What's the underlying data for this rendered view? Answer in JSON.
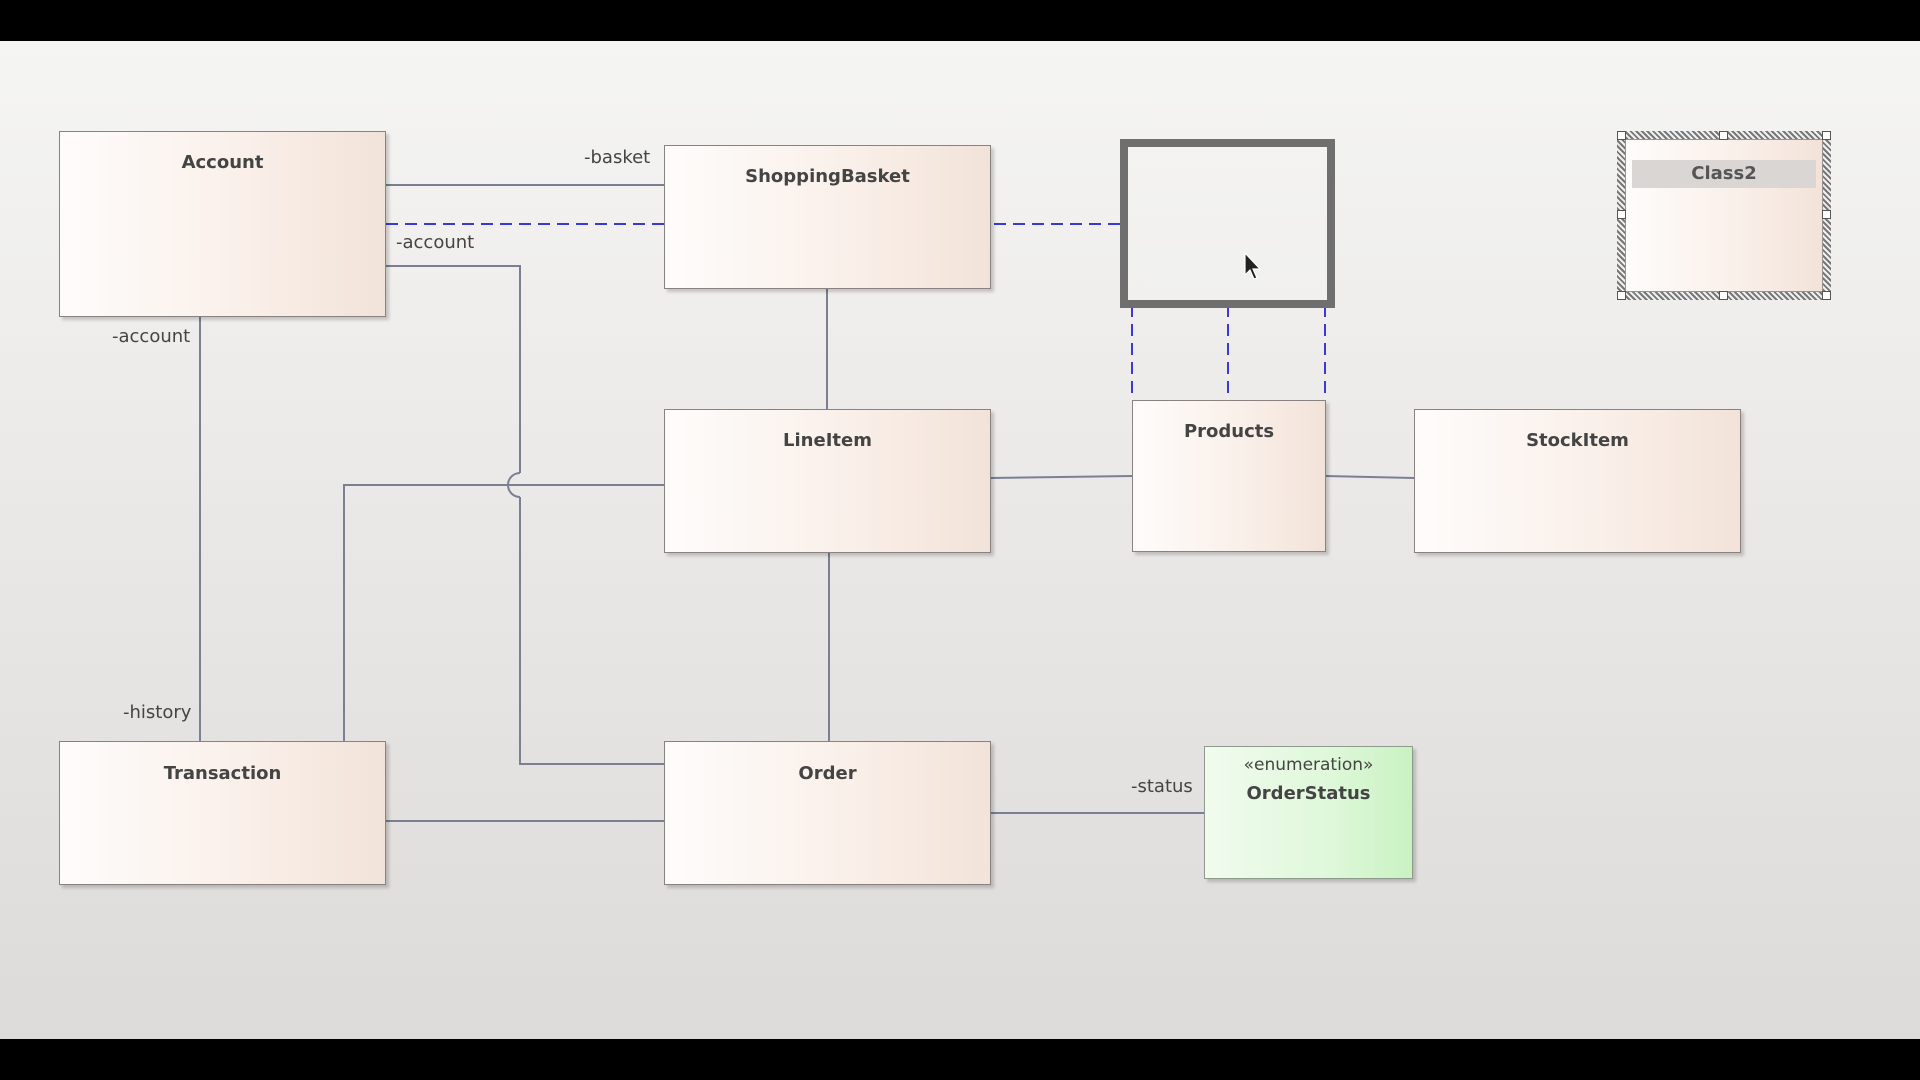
{
  "diagram": {
    "classes": {
      "account": "Account",
      "shopping_basket": "ShoppingBasket",
      "line_item": "LineItem",
      "products": "Products",
      "stock_item": "StockItem",
      "transaction": "Transaction",
      "order": "Order",
      "class2": "Class2"
    },
    "enumeration": {
      "stereotype": "«enumeration»",
      "name": "OrderStatus"
    },
    "roles": {
      "basket": "-basket",
      "account_top": "-account",
      "account_left": "-account",
      "history": "-history",
      "status": "-status"
    },
    "colors": {
      "association_line": "#7a7f94",
      "dependency_line": "#3a3ad6",
      "class_fill": "#f6ebe4",
      "enum_fill": "#d3f5cc"
    }
  }
}
